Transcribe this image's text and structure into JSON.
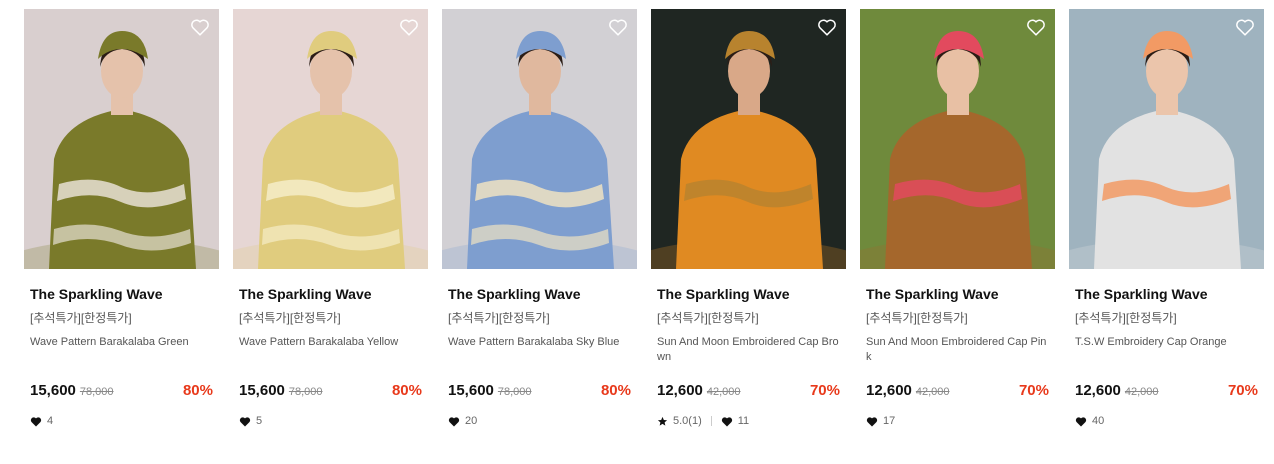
{
  "products": [
    {
      "brand": "The Sparkling Wave",
      "tags": "[추석특가][한정특가]",
      "name": "Wave Pattern Barakalaba Green",
      "price": "15,600",
      "original_price": "78,000",
      "discount": "80%",
      "rating": null,
      "likes": "4",
      "theme": {
        "bg": "#d9cfcf",
        "main": "#7a7a2a",
        "accent": "#e7e1d4",
        "skin": "#e5c2ab"
      }
    },
    {
      "brand": "The Sparkling Wave",
      "tags": "[추석특가][한정특가]",
      "name": "Wave Pattern Barakalaba Yellow",
      "price": "15,600",
      "original_price": "78,000",
      "discount": "80%",
      "rating": null,
      "likes": "5",
      "theme": {
        "bg": "#e6d6d4",
        "main": "#e0cc7e",
        "accent": "#f5ecc8",
        "skin": "#e5c2ab"
      }
    },
    {
      "brand": "The Sparkling Wave",
      "tags": "[추석특가][한정특가]",
      "name": "Wave Pattern Barakalaba Sky Blue",
      "price": "15,600",
      "original_price": "78,000",
      "discount": "80%",
      "rating": null,
      "likes": "20",
      "theme": {
        "bg": "#d2d0d4",
        "main": "#7e9ecf",
        "accent": "#efe2c2",
        "skin": "#e0b89e"
      }
    },
    {
      "brand": "The Sparkling Wave",
      "tags": "[추석특가][한정특가]",
      "name": "Sun And Moon Embroidered Cap Brown",
      "price": "12,600",
      "original_price": "42,000",
      "discount": "70%",
      "rating": "5.0(1)",
      "likes": "11",
      "theme": {
        "bg": "#1f2622",
        "main": "#e08a22",
        "accent": "#b8832e",
        "skin": "#d9a888"
      }
    },
    {
      "brand": "The Sparkling Wave",
      "tags": "[추석특가][한정특가]",
      "name": "Sun And Moon Embroidered Cap Pink",
      "price": "12,600",
      "original_price": "42,000",
      "discount": "70%",
      "rating": null,
      "likes": "17",
      "theme": {
        "bg": "#6f8a3c",
        "main": "#a5672c",
        "accent": "#e24a5e",
        "skin": "#e8c0a4"
      }
    },
    {
      "brand": "The Sparkling Wave",
      "tags": "[추석특가][한정특가]",
      "name": "T.S.W Embroidery Cap Orange",
      "price": "12,600",
      "original_price": "42,000",
      "discount": "70%",
      "rating": null,
      "likes": "40",
      "theme": {
        "bg": "#9fb3bf",
        "main": "#e2e2e2",
        "accent": "#f29a64",
        "skin": "#ebc5ab"
      }
    }
  ]
}
